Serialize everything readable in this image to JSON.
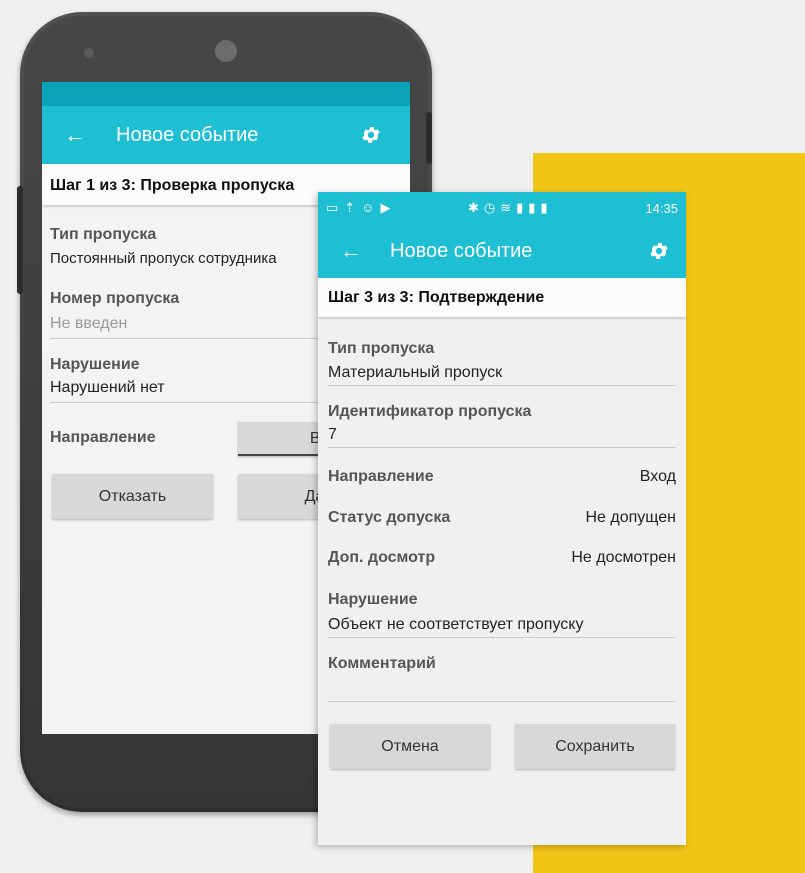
{
  "colors": {
    "accent": "#1fbfd3",
    "statusbar": "#0aa3b8",
    "yellow": "#f1c418"
  },
  "screen1": {
    "title": "Новое событие",
    "step": "Шаг 1 из 3: Проверка пропуска",
    "pass_type_label": "Тип пропуска",
    "pass_type_value": "Постоянный пропуск сотрудника",
    "pass_number_label": "Номер пропуска",
    "pass_number_placeholder": "Не введен",
    "violation_label": "Нарушение",
    "violation_value": "Нарушений нет",
    "direction_label": "Направление",
    "direction_button": "Вход",
    "reject_button": "Отказать",
    "next_button": "Далее"
  },
  "screen2": {
    "status_time": "14:35",
    "title": "Новое событие",
    "step": "Шаг 3 из 3: Подтверждение",
    "pass_type_label": "Тип пропуска",
    "pass_type_value": "Материальный пропуск",
    "pass_id_label": "Идентификатор пропуска",
    "pass_id_value": "7",
    "direction_label": "Направление",
    "direction_value": "Вход",
    "access_status_label": "Статус допуска",
    "access_status_value": "Не допущен",
    "extra_inspection_label": "Доп. досмотр",
    "extra_inspection_value": "Не досмотрен",
    "violation_label": "Нарушение",
    "violation_value": "Объект не соответствует пропуску",
    "comment_label": "Комментарий",
    "comment_value": "",
    "cancel_button": "Отмена",
    "save_button": "Сохранить"
  }
}
